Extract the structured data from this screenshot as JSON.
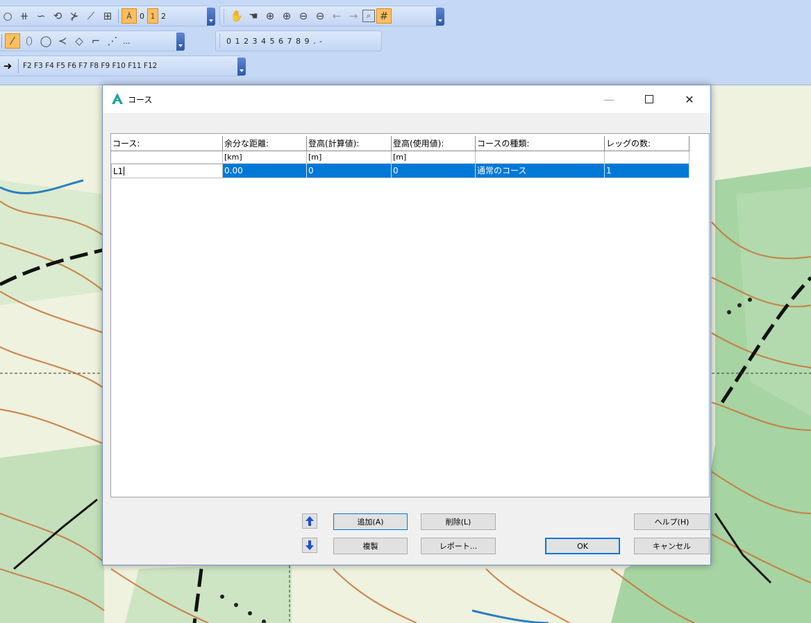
{
  "toolbar": {
    "row1": {
      "layer_labels": [
        "0",
        "1",
        "2"
      ]
    },
    "row2": {
      "more_label": "...",
      "number_keys": "0 1 2 3 4 5 6 7 8 9 . -"
    },
    "row3": {
      "fkeys": "F2 F3 F4 F5 F6 F7 F8 F9 F10 F11 F12"
    }
  },
  "dialog": {
    "title": "コース",
    "columns": [
      "コース:",
      "余分な距離:",
      "登高(計算値):",
      "登高(使用値):",
      "コースの種類:",
      "レッグの数:"
    ],
    "units": [
      "",
      "[km]",
      "[m]",
      "[m]",
      "",
      ""
    ],
    "rows": [
      [
        "L1",
        "0.00",
        "0",
        "0",
        "通常のコース",
        "1"
      ]
    ],
    "buttons": {
      "add": "追加(A)",
      "delete": "削除(L)",
      "copy": "複製",
      "report": "レポート...",
      "help": "ヘルプ(H)",
      "ok": "OK",
      "cancel": "キャンセル"
    }
  },
  "colors": {
    "selection": "#0078d7",
    "toolbar_bg": "#c5d8f5",
    "active_tool": "#ffbf5e",
    "app_icon": "#1fa39a"
  }
}
